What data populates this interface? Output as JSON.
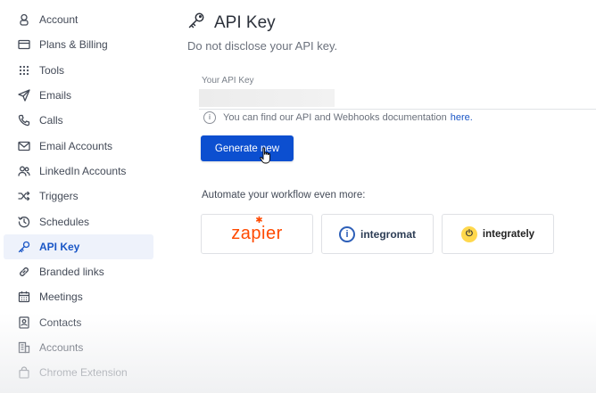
{
  "sidebar": {
    "items": [
      {
        "label": "Account",
        "icon": "user-icon"
      },
      {
        "label": "Plans & Billing",
        "icon": "credit-card-icon"
      },
      {
        "label": "Tools",
        "icon": "grid-dots-icon"
      },
      {
        "label": "Emails",
        "icon": "send-icon"
      },
      {
        "label": "Calls",
        "icon": "phone-icon"
      },
      {
        "label": "Email Accounts",
        "icon": "envelope-icon"
      },
      {
        "label": "LinkedIn Accounts",
        "icon": "users-icon"
      },
      {
        "label": "Triggers",
        "icon": "shuffle-icon"
      },
      {
        "label": "Schedules",
        "icon": "history-icon"
      },
      {
        "label": "API Key",
        "icon": "key-icon",
        "active": true
      },
      {
        "label": "Branded links",
        "icon": "link-icon"
      },
      {
        "label": "Meetings",
        "icon": "calendar-icon"
      },
      {
        "label": "Contacts",
        "icon": "contact-book-icon"
      },
      {
        "label": "Accounts",
        "icon": "building-icon"
      },
      {
        "label": "Chrome Extension",
        "icon": "shopping-bag-icon"
      }
    ]
  },
  "header": {
    "title": "API Key",
    "subtitle": "Do not disclose your API key."
  },
  "api_key": {
    "label": "Your API Key"
  },
  "info": {
    "text": "You can find our API and Webhooks documentation",
    "link": "here."
  },
  "generate_button": "Generate new",
  "automate_label": "Automate your workflow even more:",
  "integrations": {
    "zapier": "zapier",
    "integromat": "integromat",
    "integrately": "integrately"
  },
  "colors": {
    "accent": "#0c4fd0",
    "active_nav_bg": "#eef2fb",
    "zapier": "#ff4a00"
  }
}
